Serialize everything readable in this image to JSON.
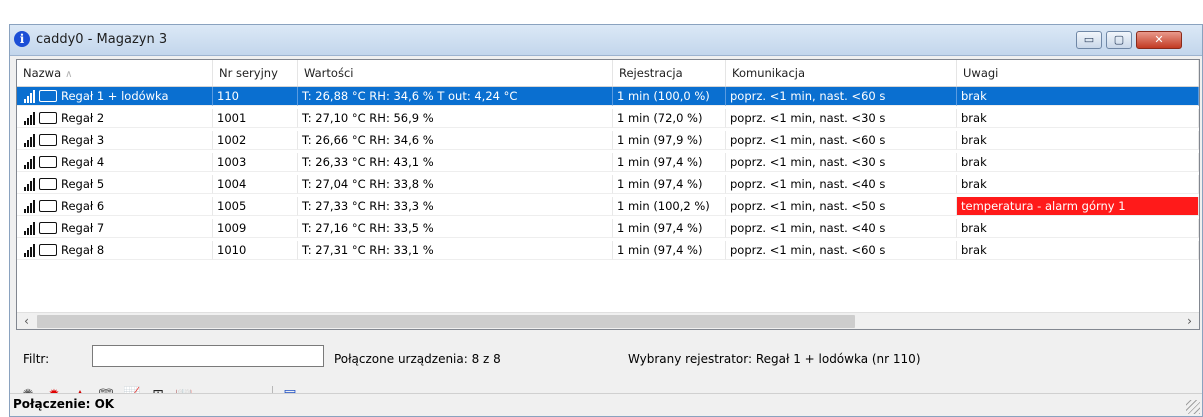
{
  "window": {
    "title": "caddy0 - Magazyn 3",
    "controls": {
      "minimize": "▭",
      "maximize": "▢",
      "close": "✕"
    }
  },
  "table": {
    "columns": [
      "Nazwa",
      "Nr seryjny",
      "Wartości",
      "Rejestracja",
      "Komunikacja",
      "Uwagi"
    ],
    "rows": [
      {
        "name": "Regał 1 + lodówka",
        "serial": "110",
        "values": "T: 26,88 °C  RH: 34,6 %  T out: 4,24 °C",
        "registration": "1 min (100,0 %)",
        "communication": "poprz. <1 min, nast. <60 s",
        "notes": "brak",
        "selected": true,
        "alarm": false
      },
      {
        "name": "Regał 2",
        "serial": "1001",
        "values": "T: 27,10 °C  RH: 56,9 %",
        "registration": "1 min (72,0 %)",
        "communication": "poprz. <1 min, nast. <30 s",
        "notes": "brak",
        "selected": false,
        "alarm": false
      },
      {
        "name": "Regał 3",
        "serial": "1002",
        "values": "T: 26,66 °C  RH: 34,6 %",
        "registration": "1 min (97,9 %)",
        "communication": "poprz. <1 min, nast. <60 s",
        "notes": "brak",
        "selected": false,
        "alarm": false
      },
      {
        "name": "Regał 4",
        "serial": "1003",
        "values": "T: 26,33 °C  RH: 43,1 %",
        "registration": "1 min (97,4 %)",
        "communication": "poprz. <1 min, nast. <30 s",
        "notes": "brak",
        "selected": false,
        "alarm": false
      },
      {
        "name": "Regał 5",
        "serial": "1004",
        "values": "T: 27,04 °C  RH: 33,8 %",
        "registration": "1 min (97,4 %)",
        "communication": "poprz. <1 min, nast. <40 s",
        "notes": "brak",
        "selected": false,
        "alarm": false
      },
      {
        "name": "Regał 6",
        "serial": "1005",
        "values": "T: 27,33 °C  RH: 33,3 %",
        "registration": "1 min (100,2 %)",
        "communication": "poprz. <1 min, nast. <50 s",
        "notes": "temperatura - alarm górny 1",
        "selected": false,
        "alarm": true
      },
      {
        "name": "Regał 7",
        "serial": "1009",
        "values": "T: 27,16 °C  RH: 33,5 %",
        "registration": "1 min (97,4 %)",
        "communication": "poprz. <1 min, nast. <40 s",
        "notes": "brak",
        "selected": false,
        "alarm": false
      },
      {
        "name": "Regał 8",
        "serial": "1010",
        "values": "T: 27,31 °C  RH: 33,1 %",
        "registration": "1 min (97,4 %)",
        "communication": "poprz. <1 min, nast. <60 s",
        "notes": "brak",
        "selected": false,
        "alarm": false
      }
    ]
  },
  "scrollbar": {
    "left": "‹",
    "right": "›"
  },
  "filter": {
    "label": "Filtr:",
    "value": ""
  },
  "info": {
    "connected": "Połączone urządzenia: 8 z 8",
    "selected_recorder": "Wybrany rejestrator: Regał 1 + lodówka (nr 110)"
  },
  "toolbar": [
    {
      "name": "sun-gray-icon",
      "glyph": "✺",
      "color": "#555555"
    },
    {
      "name": "sun-red-icon",
      "glyph": "✹",
      "color": "#e00000"
    },
    {
      "name": "alarm-light-icon",
      "glyph": "▲",
      "color": "#d00000"
    },
    {
      "name": "book-icon",
      "glyph": "🕮",
      "color": "#222222"
    },
    {
      "name": "chart-icon",
      "glyph": "📈",
      "color": "#7a1fb0"
    },
    {
      "name": "table-icon",
      "glyph": "⊞",
      "color": "#222222"
    },
    {
      "name": "book-search-icon",
      "glyph": "📖",
      "color": "#222222"
    },
    {
      "name": "device-config-icon",
      "glyph": "▤",
      "color": "#1d4fc4"
    }
  ],
  "status": {
    "text": "Połączenie: OK"
  },
  "colors": {
    "selection": "#0a6fd0",
    "alarm": "#ff1a1a"
  }
}
